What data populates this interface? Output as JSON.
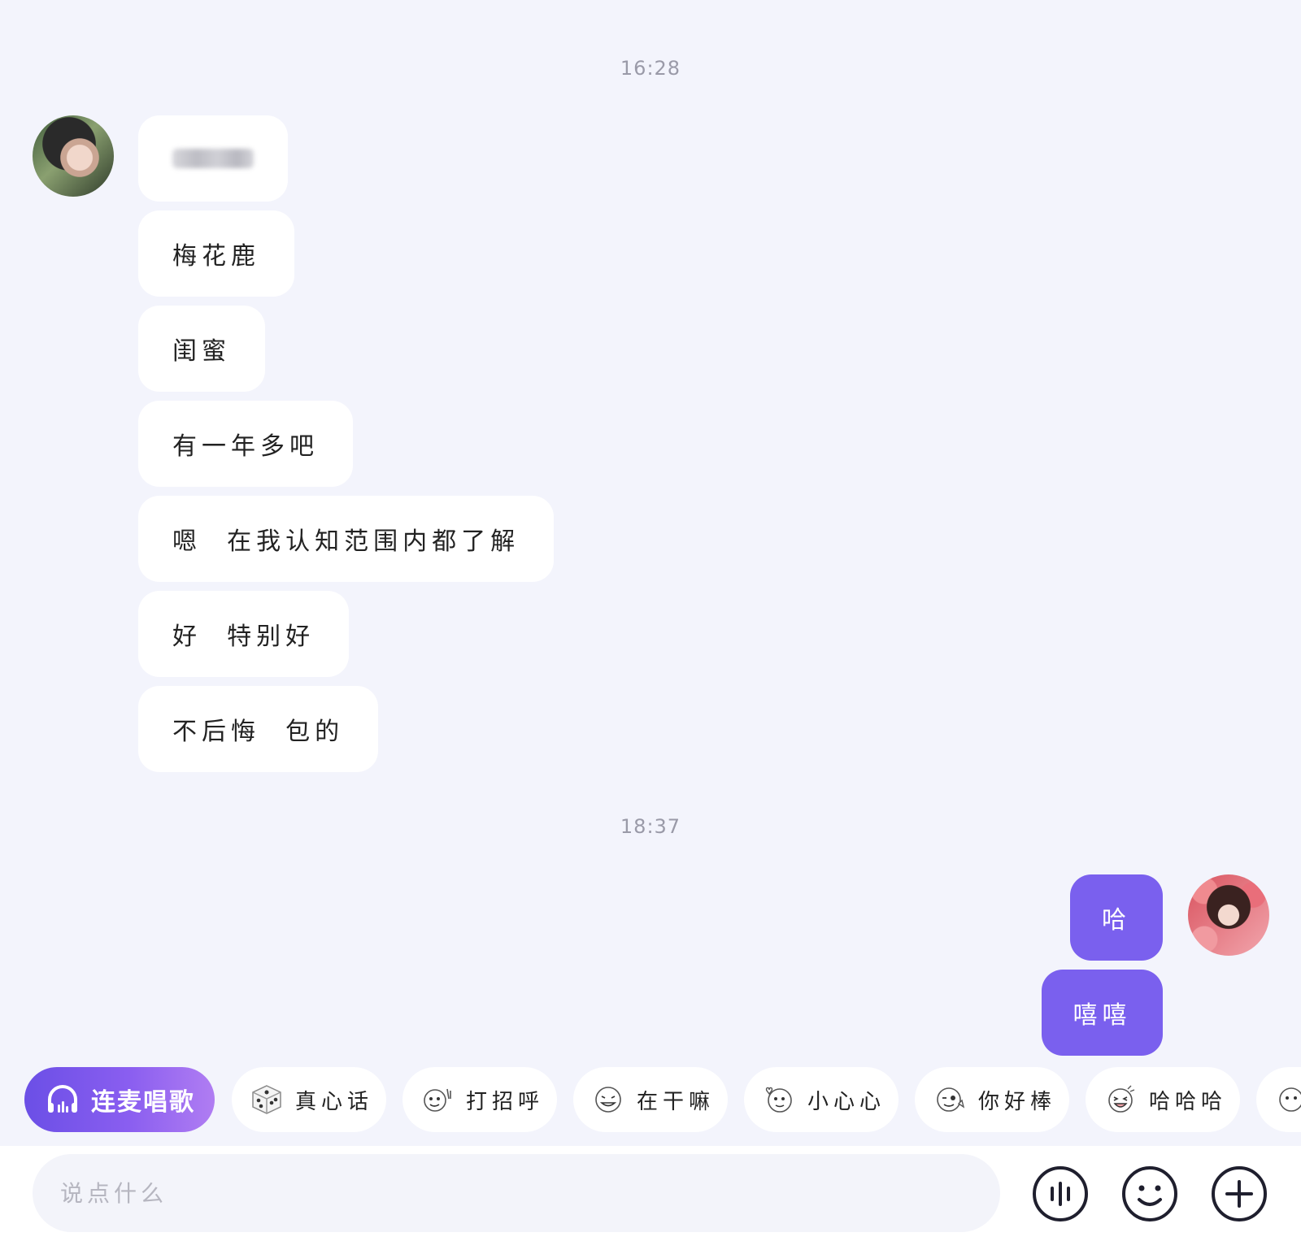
{
  "timestamps": [
    "16:28",
    "18:37"
  ],
  "incoming_messages": [
    "梅花鹿",
    "闺蜜",
    "有一年多吧",
    "嗯  在我认知范围内都了解",
    "好  特别好",
    "不后悔  包的"
  ],
  "outgoing_messages": [
    "哈",
    "嘻嘻"
  ],
  "quick_actions": {
    "karaoke_label": "连麦唱歌",
    "chips": [
      "真心话",
      "打招呼",
      "在干嘛",
      "小心心",
      "你好棒",
      "哈哈哈"
    ]
  },
  "input": {
    "placeholder": "说点什么"
  },
  "colors": {
    "background": "#f3f4fc",
    "outgoing_bubble": "#7a60ee",
    "incoming_bubble": "#ffffff",
    "karaoke_gradient_start": "#6b4fe6"
  },
  "icons": [
    "headphones-icon",
    "dice-icon",
    "voice-icon",
    "emoji-icon",
    "plus-icon"
  ]
}
